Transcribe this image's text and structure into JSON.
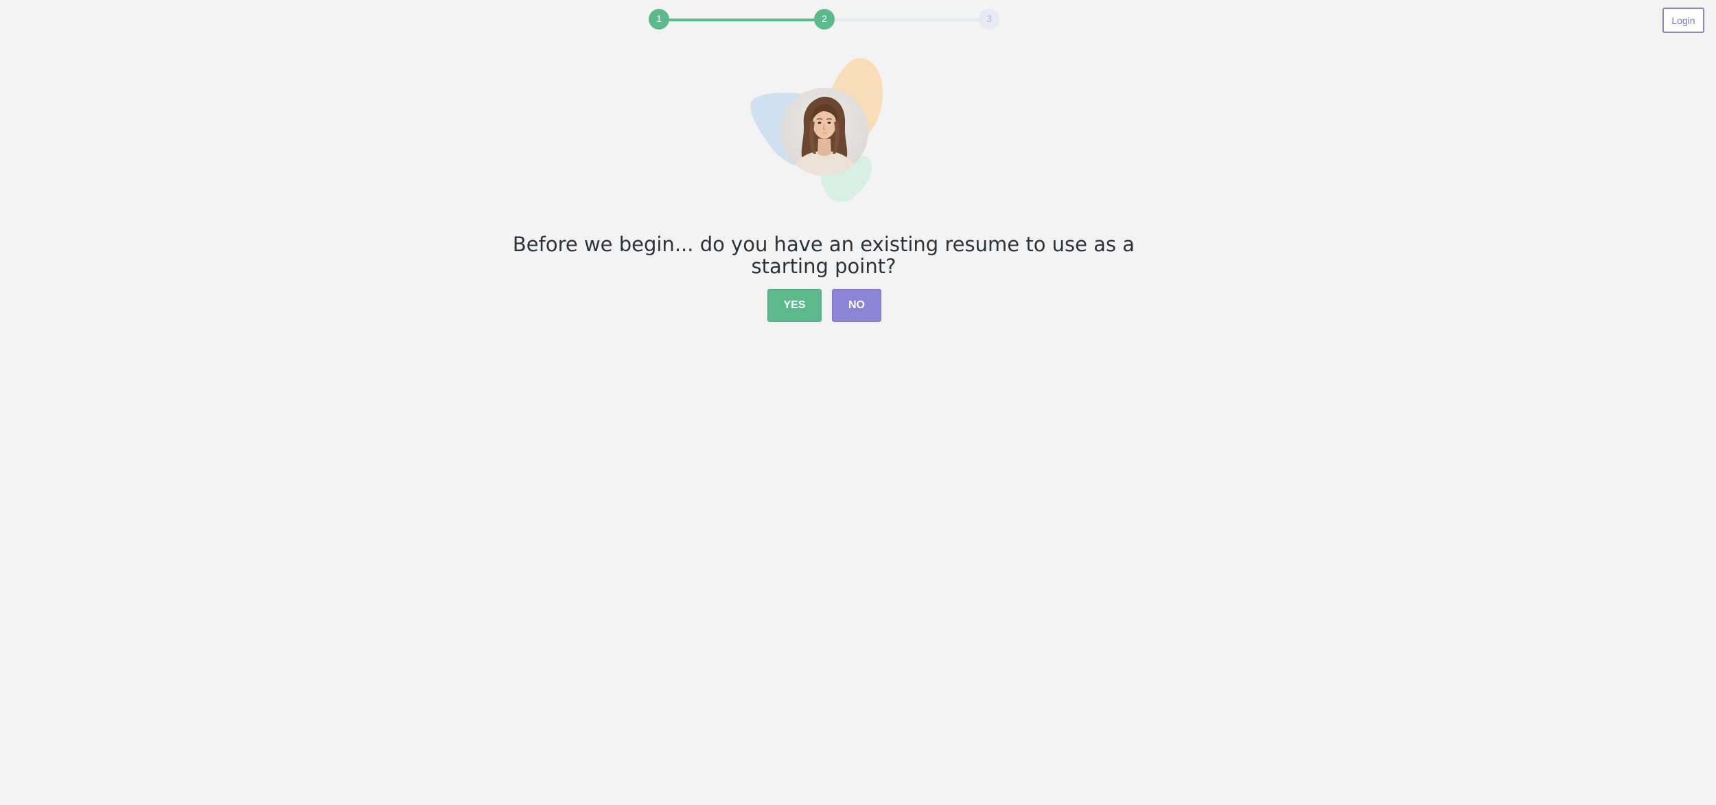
{
  "stepper": {
    "steps": [
      {
        "label": "1",
        "state": "done"
      },
      {
        "label": "2",
        "state": "done"
      },
      {
        "label": "3",
        "state": "todo"
      }
    ],
    "current_step": 2
  },
  "header": {
    "login_label": "Login"
  },
  "hero": {
    "image": "woman-portrait-avatar"
  },
  "main": {
    "question": "Before we begin... do you have an existing resume to use as a starting point?",
    "yes_label": "YES",
    "no_label": "NO"
  },
  "colors": {
    "green": "#5cb98c",
    "purple": "#8b84d7",
    "background": "#f3f3f3",
    "text": "#2d3237"
  }
}
